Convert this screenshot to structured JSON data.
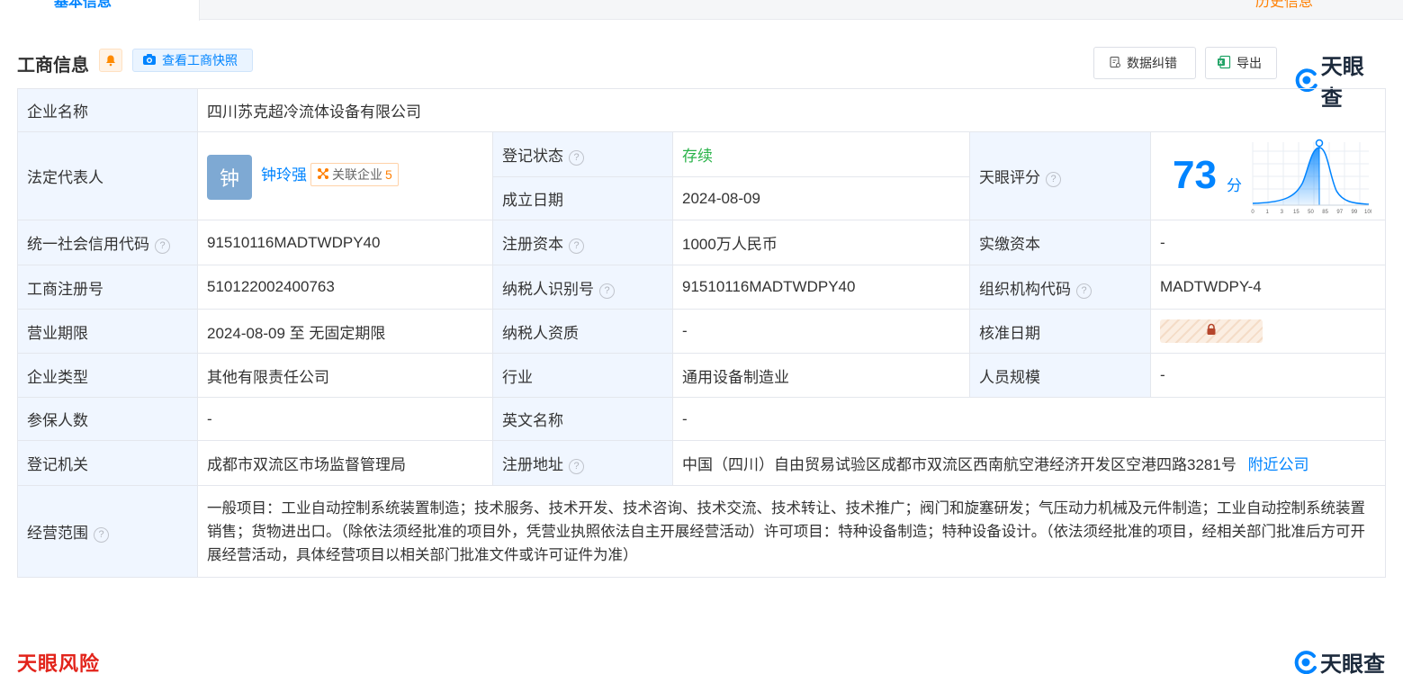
{
  "top_tabs": {
    "active_label": "基本信息",
    "orange_label": "历史信息"
  },
  "header": {
    "title": "工商信息",
    "snapshot_label": "查看工商快照",
    "correction_label": "数据纠错",
    "export_label": "导出",
    "logo_text": "天眼查"
  },
  "rows": {
    "company_name": {
      "label": "企业名称",
      "value": "四川苏克超冷流体设备有限公司"
    },
    "legal_rep": {
      "label": "法定代表人",
      "avatar_char": "钟",
      "name": "钟玲强",
      "related_label": "关联企业",
      "related_count": "5"
    },
    "reg_status": {
      "label": "登记状态",
      "value": "存续"
    },
    "found_date": {
      "label": "成立日期",
      "value": "2024-08-09"
    },
    "score": {
      "label": "天眼评分",
      "value": "73",
      "unit": "分",
      "axis_ticks": [
        "0",
        "1",
        "3",
        "15",
        "50",
        "85",
        "97",
        "99",
        "100"
      ]
    },
    "credit_code": {
      "label": "统一社会信用代码",
      "value": "91510116MADTWDPY40"
    },
    "reg_capital": {
      "label": "注册资本",
      "value": "1000万人民币"
    },
    "paid_capital": {
      "label": "实缴资本",
      "value": "-"
    },
    "reg_no": {
      "label": "工商注册号",
      "value": "510122002400763"
    },
    "taxpayer_id": {
      "label": "纳税人识别号",
      "value": "91510116MADTWDPY40"
    },
    "org_code": {
      "label": "组织机构代码",
      "value": "MADTWDPY-4"
    },
    "term": {
      "label": "营业期限",
      "value": "2024-08-09 至 无固定期限"
    },
    "taxpayer_qual": {
      "label": "纳税人资质",
      "value": "-"
    },
    "approve_date": {
      "label": "核准日期"
    },
    "company_type": {
      "label": "企业类型",
      "value": "其他有限责任公司"
    },
    "industry": {
      "label": "行业",
      "value": "通用设备制造业"
    },
    "staff_size": {
      "label": "人员规模",
      "value": "-"
    },
    "insured": {
      "label": "参保人数",
      "value": "-"
    },
    "english_name": {
      "label": "英文名称",
      "value": "-"
    },
    "reg_authority": {
      "label": "登记机关",
      "value": "成都市双流区市场监督管理局"
    },
    "reg_address": {
      "label": "注册地址",
      "value": "中国（四川）自由贸易试验区成都市双流区西南航空港经济开发区空港四路3281号",
      "nearby_link": "附近公司"
    },
    "scope": {
      "label": "经营范围",
      "value": "一般项目：工业自动控制系统装置制造；技术服务、技术开发、技术咨询、技术交流、技术转让、技术推广；阀门和旋塞研发；气压动力机械及元件制造；工业自动控制系统装置销售；货物进出口。（除依法须经批准的项目外，凭营业执照依法自主开展经营活动）许可项目：特种设备制造；特种设备设计。（依法须经批准的项目，经相关部门批准后方可开展经营活动，具体经营项目以相关部门批准文件或许可证件为准）"
    }
  },
  "footer": {
    "risk_title": "天眼风险",
    "logo_text": "天眼查"
  },
  "colors": {
    "accent": "#0084ff",
    "status_green": "#2ab34a",
    "label_bg": "#f0f6ff",
    "risk_red": "#e2231a"
  }
}
